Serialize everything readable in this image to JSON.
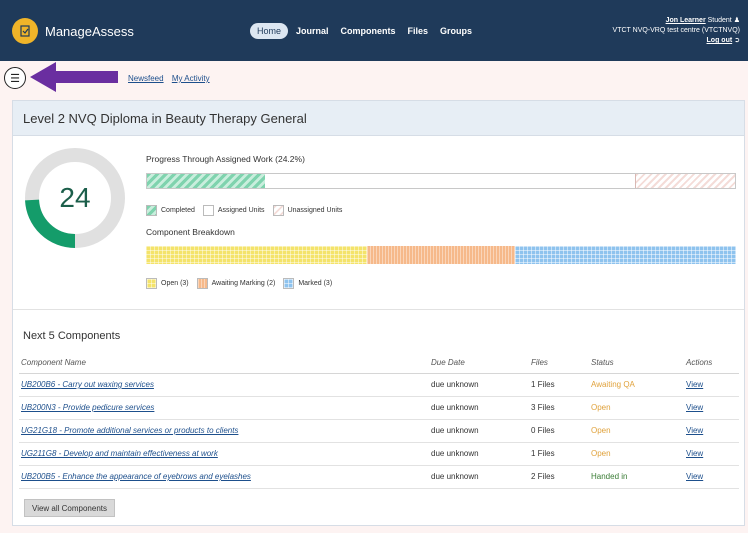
{
  "app": {
    "brand": "ManageAssess",
    "nav": [
      "Home",
      "Journal",
      "Components",
      "Files",
      "Groups"
    ],
    "user_name": "Jon Learner",
    "user_role": "Student",
    "centre": "VTCT NVQ-VRQ test centre (VTCTNVQ)",
    "logout": "Log out"
  },
  "subnav": {
    "links": [
      "Newsfeed",
      "My Activity"
    ]
  },
  "card": {
    "title": "Level 2 NVQ Diploma in Beauty Therapy General",
    "donut_value": "24",
    "donut_fraction": 0.242,
    "progress_title": "Progress Through Assigned Work (24.2%)",
    "progress": {
      "completed": 0.242,
      "assigned": 0.758,
      "unassigned_fraction_of_row": 0.17
    },
    "progress_legend": [
      "Completed",
      "Assigned Units",
      "Unassigned Units"
    ],
    "breakdown_title": "Component Breakdown",
    "breakdown": {
      "open": 3,
      "awaiting": 2,
      "marked": 3
    },
    "breakdown_legend": [
      "Open (3)",
      "Awaiting Marking (2)",
      "Marked (3)"
    ],
    "colors": {
      "completed": "#7fd3ae",
      "open": "#f4e36a",
      "awaiting": "#f6b98a",
      "marked": "#8ec3ee",
      "donut": "#149c6a"
    }
  },
  "components": {
    "title": "Next 5 Components",
    "headers": [
      "Component Name",
      "Due Date",
      "Files",
      "Status",
      "Actions"
    ],
    "rows": [
      {
        "name": "UB200B6 - Carry out waxing services",
        "due": "due unknown",
        "files": "1 Files",
        "status": "Awaiting QA",
        "action": "View"
      },
      {
        "name": "UB200N3 - Provide pedicure services",
        "due": "due unknown",
        "files": "3 Files",
        "status": "Open",
        "action": "View"
      },
      {
        "name": "UG21G18 - Promote additional services or products to clients",
        "due": "due unknown",
        "files": "0 Files",
        "status": "Open",
        "action": "View"
      },
      {
        "name": "UG211G8 - Develop and maintain effectiveness at work",
        "due": "due unknown",
        "files": "1 Files",
        "status": "Open",
        "action": "View"
      },
      {
        "name": "UB200B5 - Enhance the appearance of eyebrows and eyelashes",
        "due": "due unknown",
        "files": "2 Files",
        "status": "Handed in",
        "action": "View"
      }
    ],
    "view_all": "View all Components"
  }
}
